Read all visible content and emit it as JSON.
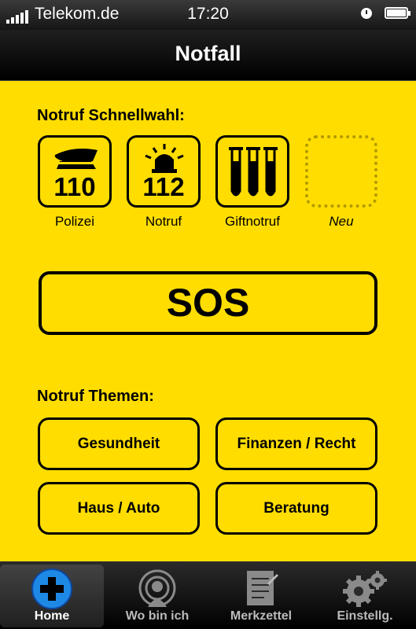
{
  "status_bar": {
    "carrier": "Telekom.de",
    "time": "17:20"
  },
  "nav": {
    "title": "Notfall"
  },
  "quick_dial": {
    "title": "Notruf Schnellwahl:",
    "items": [
      {
        "number": "110",
        "label": "Polizei",
        "icon": "police-cap-icon"
      },
      {
        "number": "112",
        "label": "Notruf",
        "icon": "siren-icon"
      },
      {
        "number": "",
        "label": "Giftnotruf",
        "icon": "test-tubes-icon"
      },
      {
        "number": "",
        "label": "Neu",
        "icon": "empty-slot"
      }
    ]
  },
  "sos": {
    "label": "SOS"
  },
  "topics": {
    "title": "Notruf Themen:",
    "items": [
      "Gesundheit",
      "Finanzen / Recht",
      "Haus / Auto",
      "Beratung"
    ]
  },
  "tab_bar": {
    "active": "Home",
    "tabs": [
      {
        "label": "Home",
        "icon": "plus-circle-icon"
      },
      {
        "label": "Wo bin ich",
        "icon": "location-person-icon"
      },
      {
        "label": "Merkzettel",
        "icon": "notepad-icon"
      },
      {
        "label": "Einstellg.",
        "icon": "gears-icon"
      }
    ]
  },
  "colors": {
    "background": "#ffdd00",
    "bars": "#000000",
    "neu_border": "#b39a00"
  }
}
